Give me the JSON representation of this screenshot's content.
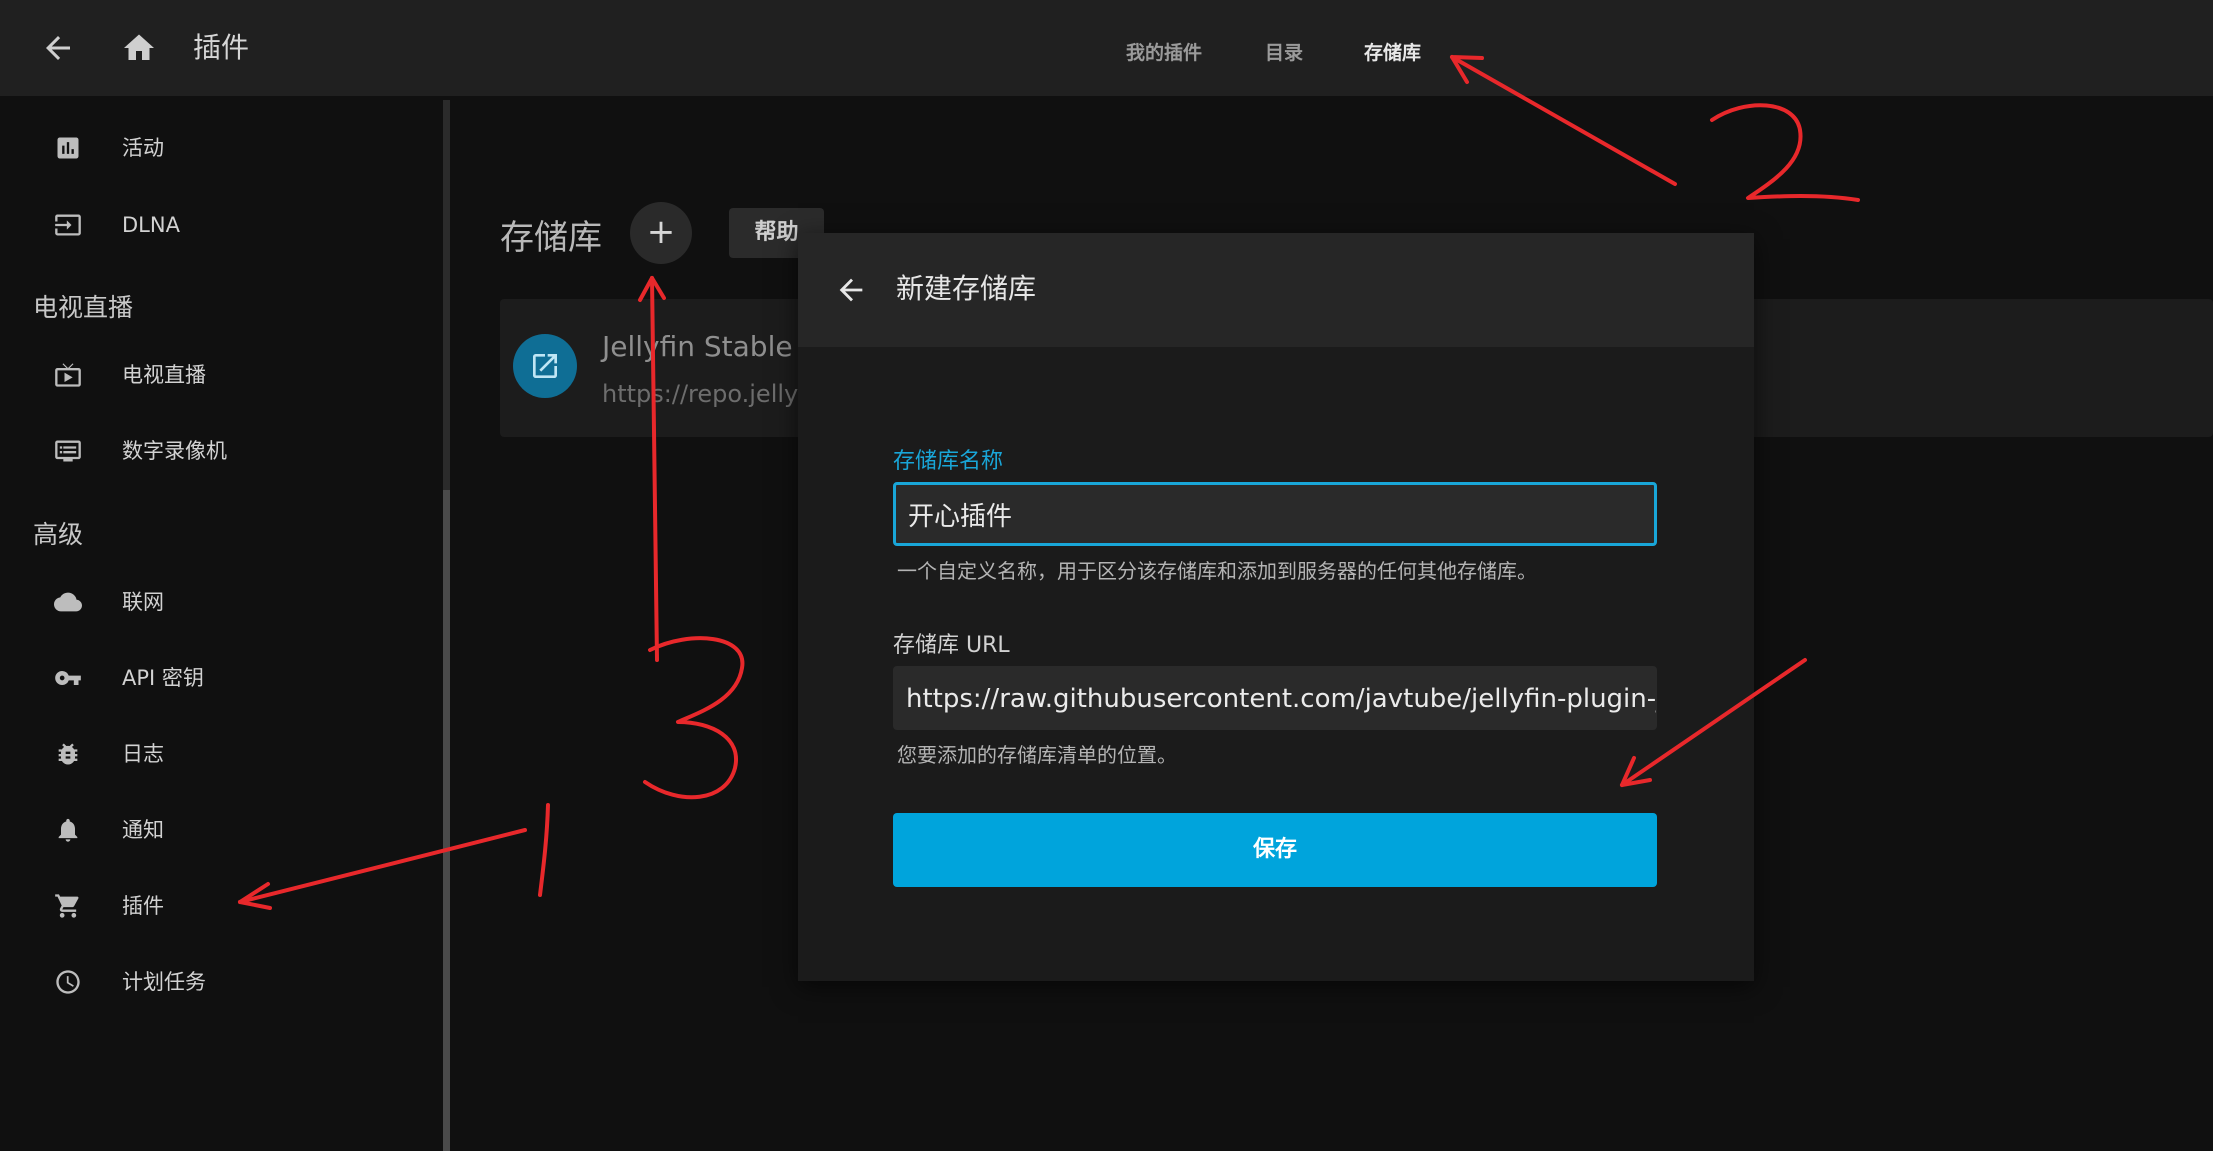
{
  "header": {
    "title": "插件",
    "tabs": [
      {
        "label": "我的插件",
        "active": false
      },
      {
        "label": "目录",
        "active": false
      },
      {
        "label": "存储库",
        "active": true
      }
    ]
  },
  "sidebar": {
    "items_top": [
      {
        "label": "活动",
        "icon": "chart-icon"
      },
      {
        "label": "DLNA",
        "icon": "input-icon"
      }
    ],
    "section_livetv": "电视直播",
    "items_livetv": [
      {
        "label": "电视直播",
        "icon": "tv-icon"
      },
      {
        "label": "数字录像机",
        "icon": "dvr-icon"
      }
    ],
    "section_advanced": "高级",
    "items_advanced": [
      {
        "label": "联网",
        "icon": "cloud-icon"
      },
      {
        "label": "API 密钥",
        "icon": "key-icon"
      },
      {
        "label": "日志",
        "icon": "bug-icon"
      },
      {
        "label": "通知",
        "icon": "bell-icon"
      },
      {
        "label": "插件",
        "icon": "cart-icon"
      },
      {
        "label": "计划任务",
        "icon": "clock-icon"
      }
    ]
  },
  "main": {
    "title": "存储库",
    "add_label": "+",
    "help_label": "帮助",
    "repo": {
      "name": "Jellyfin Stable",
      "url": "https://repo.jellyf"
    }
  },
  "dialog": {
    "title": "新建存储库",
    "name_label": "存储库名称",
    "name_value": "开心插件",
    "name_help": "一个自定义名称，用于区分该存储库和添加到服务器的任何其他存储库。",
    "url_label": "存储库 URL",
    "url_value": "https://raw.githubusercontent.com/javtube/jellyfin-plugin-ja",
    "url_help": "您要添加的存储库清单的位置。",
    "save_label": "保存"
  },
  "annotations": {
    "color": "#e8282b"
  },
  "colors": {
    "accent": "#00a4dc",
    "header_bg": "#202020",
    "page_bg": "#101010"
  }
}
